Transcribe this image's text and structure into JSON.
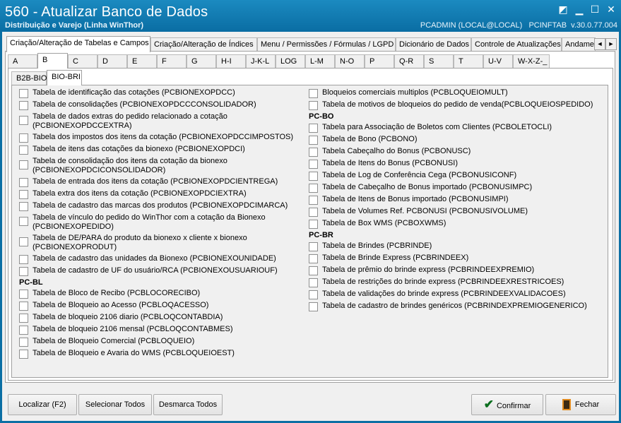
{
  "window": {
    "title": "560 - Atualizar Banco de Dados",
    "subtitle": "Distribuição e Varejo (Linha WinThor)",
    "info": "PCADMIN (LOCAL@LOCAL)   PCINFTAB  v.30.0.77.004"
  },
  "top_tabs": [
    "Criação/Alteração de Tabelas e Campos",
    "Criação/Alteração de Índices",
    "Menu / Permissões / Fórmulas / LGPD",
    "Dicionário de Dados",
    "Controle de Atualizações",
    "Andame"
  ],
  "tab_scroll": {
    "left": "◄",
    "right": "►"
  },
  "letter_tabs": [
    "A",
    "B",
    "C",
    "D",
    "E",
    "F",
    "G",
    "H-I",
    "J-K-L",
    "LOG",
    "L-M",
    "N-O",
    "P",
    "Q-R",
    "S",
    "T",
    "U-V",
    "W-X-Z-_"
  ],
  "sub_tabs": [
    "B2B-BIO",
    "BIO-BRI"
  ],
  "left_column": {
    "items_top": [
      "Tabela de identificação das cotações (PCBIONEXOPDCC)",
      "Tabela de consolidações (PCBIONEXOPDCCCONSOLIDADOR)",
      "Tabela de dados extras do pedido relacionado a cotação",
      "(PCBIONEXOPDCCEXTRA)",
      "Tabela dos impostos dos itens da cotação (PCBIONEXOPDCCIMPOSTOS)",
      "Tabela de itens das cotações da bionexo (PCBIONEXOPDCI)",
      "Tabela de consolidação dos itens da cotação da bionexo",
      "(PCBIONEXOPDCICONSOLIDADOR)",
      "Tabela de entrada dos itens da cotação (PCBIONEXOPDCIENTREGA)",
      "Tabela extra dos itens da cotação (PCBIONEXOPDCIEXTRA)",
      "Tabela de cadastro das marcas dos produtos (PCBIONEXOPDCIMARCA)",
      "Tabela de vínculo do pedido do WinThor com a cotação da Bionexo",
      "(PCBIONEXOPEDIDO)",
      "Tabela de DE/PARA do produto da bionexo x cliente x bionexo",
      "(PCBIONEXOPRODUT)",
      "Tabela de cadastro das unidades da Bionexo (PCBIONEXOUNIDADE)",
      "Tabela de cadastro de UF do usuário/RCA (PCBIONEXOUSUARIOUF)"
    ],
    "group_bl": "PC-BL",
    "items_bl": [
      "Tabela de Bloco de Recibo (PCBLOCORECIBO)",
      "Tabela de Bloqueio ao Acesso (PCBLOQACESSO)",
      "Tabela de bloqueio 2106 diario (PCBLOQCONTABDIA)",
      "Tabela de bloqueio 2106 mensal (PCBLOQCONTABMES)",
      "Tabela de Bloqueio Comercial (PCBLOQUEIO)",
      "Tabela de Bloqueio e Avaria do WMS (PCBLOQUEIOEST)"
    ]
  },
  "right_column": {
    "items_top": [
      "Bloqueios comerciais multiplos (PCBLOQUEIOMULT)",
      "Tabela de motivos de bloqueios do pedido de venda(PCBLOQUEIOSPEDIDO)"
    ],
    "group_bo": "PC-BO",
    "items_bo": [
      "Tabela para Associação de Boletos com Clientes (PCBOLETOCLI)",
      "Tabela de Bono (PCBONO)",
      "Tabela Cabeçalho do Bonus (PCBONUSC)",
      "Tabela de Itens do Bonus (PCBONUSI)",
      "Tabela de Log de Conferência Cega (PCBONUSICONF)",
      "Tabela de Cabeçalho de Bonus importado (PCBONUSIMPC)",
      "Tabela de Itens de Bonus importado (PCBONUSIMPI)",
      "Tabela de Volumes Ref. PCBONUSI (PCBONUSIVOLUME)",
      "Tabela de Box WMS (PCBOXWMS)"
    ],
    "group_br": "PC-BR",
    "items_br": [
      "Tabela de Brindes (PCBRINDE)",
      "Tabela de Brinde Express (PCBRINDEEX)",
      "Tabela de prêmio do brinde express (PCBRINDEEXPREMIO)",
      "Tabela de restrições do brinde express (PCBRINDEEXRESTRICOES)",
      "Tabela de validações do brinde express (PCBRINDEEXVALIDACOES)",
      "Tabela de cadastro de brindes genéricos (PCBRINDEXPREMIOGENERICO)"
    ]
  },
  "buttons": {
    "localizar": "Localizar (F2)",
    "selecionar_todos": "Selecionar Todos",
    "desmarca_todos": "Desmarca Todos",
    "confirmar": "Confirmar",
    "fechar": "Fechar"
  },
  "colors": {
    "titlebar": "#0a6da3",
    "panel": "#f0f0f0"
  },
  "icons": [
    "minimize-icon",
    "restore-icon",
    "close-icon",
    "check-icon",
    "exit-door-icon"
  ]
}
